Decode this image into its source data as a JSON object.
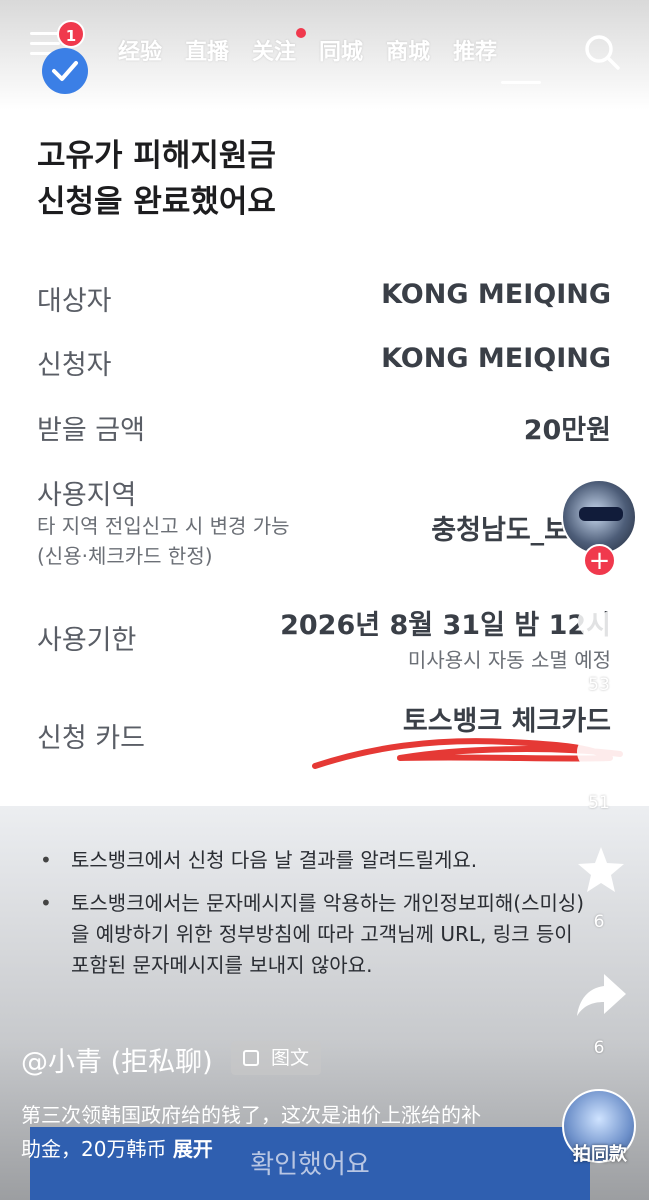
{
  "topbar": {
    "notification_count": "1",
    "tabs": [
      {
        "label": "经验"
      },
      {
        "label": "直播"
      },
      {
        "label": "关注"
      },
      {
        "label": "同城"
      },
      {
        "label": "商城"
      },
      {
        "label": "推荐"
      }
    ],
    "active_tab": "推荐"
  },
  "page": {
    "title_line1": "고유가 피해지원금",
    "title_line2": "신청을 완료했어요",
    "rows": [
      {
        "label": "대상자",
        "value": "KONG MEIQING"
      },
      {
        "label": "신청자",
        "value": "KONG MEIQING"
      },
      {
        "label": "받을 금액",
        "value": "20만원"
      },
      {
        "label": "사용지역",
        "value": "충청남도_보",
        "note1": "타 지역 전입신고 시 변경 가능",
        "note2": "(신용·체크카드 한정)"
      },
      {
        "label": "사용기한",
        "value": "2026년 8월 31일 밤 12시",
        "note": "미사용시 자동 소멸 예정"
      },
      {
        "label": "신청 카드",
        "value": "토스뱅크 체크카드"
      }
    ],
    "bullets": [
      "토스뱅크에서 신청 다음 날 결과를 알려드릴게요.",
      "토스뱅크에서는 문자메시지를 악용하는 개인정보피해(스미싱)을 예방하기 위한 정부방침에 따라 고객님께 URL, 링크 등이 포함된 문자메시지를 보내지 않아요."
    ],
    "confirm_button": "확인했어요"
  },
  "post": {
    "author": "@小青 (拒私聊)",
    "type_tag": "图文",
    "caption": "第三次领韩国政府给的钱了，这次是油价上涨给的补助金，20万韩币",
    "expand_label": "展开"
  },
  "rail": {
    "likes": "53",
    "comments": "51",
    "favorites": "6",
    "shares": "6",
    "same_style_label": "拍同款"
  },
  "colors": {
    "accent_red": "#f0394d",
    "check_blue": "#3b7fe6",
    "button_blue": "#2f5fb0",
    "redline": "#e53935"
  }
}
